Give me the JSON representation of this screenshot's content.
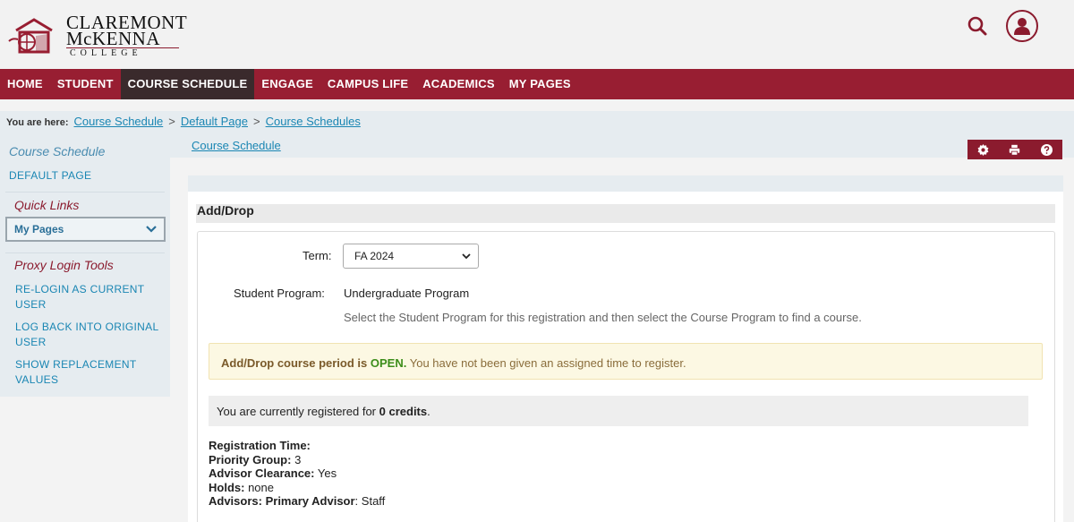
{
  "logo": {
    "line1": "CLAREMONT",
    "line2": "McKENNA",
    "line3": "COLLEGE"
  },
  "header": {
    "search_icon": "search-icon",
    "user_icon": "user-icon"
  },
  "nav": {
    "items": [
      "HOME",
      "STUDENT",
      "COURSE SCHEDULE",
      "ENGAGE",
      "CAMPUS LIFE",
      "ACADEMICS",
      "MY PAGES"
    ],
    "active": "COURSE SCHEDULE"
  },
  "breadcrumb": {
    "label": "You are here:",
    "items": [
      "Course Schedule",
      "Default Page",
      "Course Schedules"
    ],
    "separator": ">"
  },
  "sub_link": "Course Schedule",
  "toolbar": {
    "icons": [
      "gear-icon",
      "print-icon",
      "help-icon"
    ]
  },
  "sidebar": {
    "section1_title": "Course Schedule",
    "default_page": "DEFAULT PAGE",
    "section2_title": "Quick Links",
    "quick_links_selected": "My Pages",
    "section3_title": "Proxy Login Tools",
    "proxy_links": [
      "RE-LOGIN AS CURRENT USER",
      "LOG BACK INTO ORIGINAL USER",
      "SHOW REPLACEMENT VALUES"
    ]
  },
  "main": {
    "section_title": "Add/Drop",
    "term_label": "Term:",
    "term_value": "FA 2024",
    "program_label": "Student Program:",
    "program_value": "Undergraduate Program",
    "program_help": "Select the Student Program for this registration and then select the Course Program to find a course.",
    "alert_lead": "Add/Drop course period is",
    "alert_status": "OPEN.",
    "alert_rest": "You have not been given an assigned time to register.",
    "credits_prefix": "You are currently registered for",
    "credits_value": "0 credits",
    "credits_suffix": ".",
    "details": {
      "registration_time_label": "Registration Time:",
      "registration_time_value": "",
      "priority_group_label": "Priority Group:",
      "priority_group_value": "3",
      "advisor_clearance_label": "Advisor Clearance:",
      "advisor_clearance_value": "Yes",
      "holds_label": "Holds:",
      "holds_value": "none",
      "advisors_label": "Advisors:",
      "primary_advisor_label": "Primary Advisor",
      "primary_advisor_value": "Staff"
    }
  },
  "colors": {
    "brand": "#981e32",
    "link": "#1a86b3",
    "open": "#3c8d1a"
  }
}
